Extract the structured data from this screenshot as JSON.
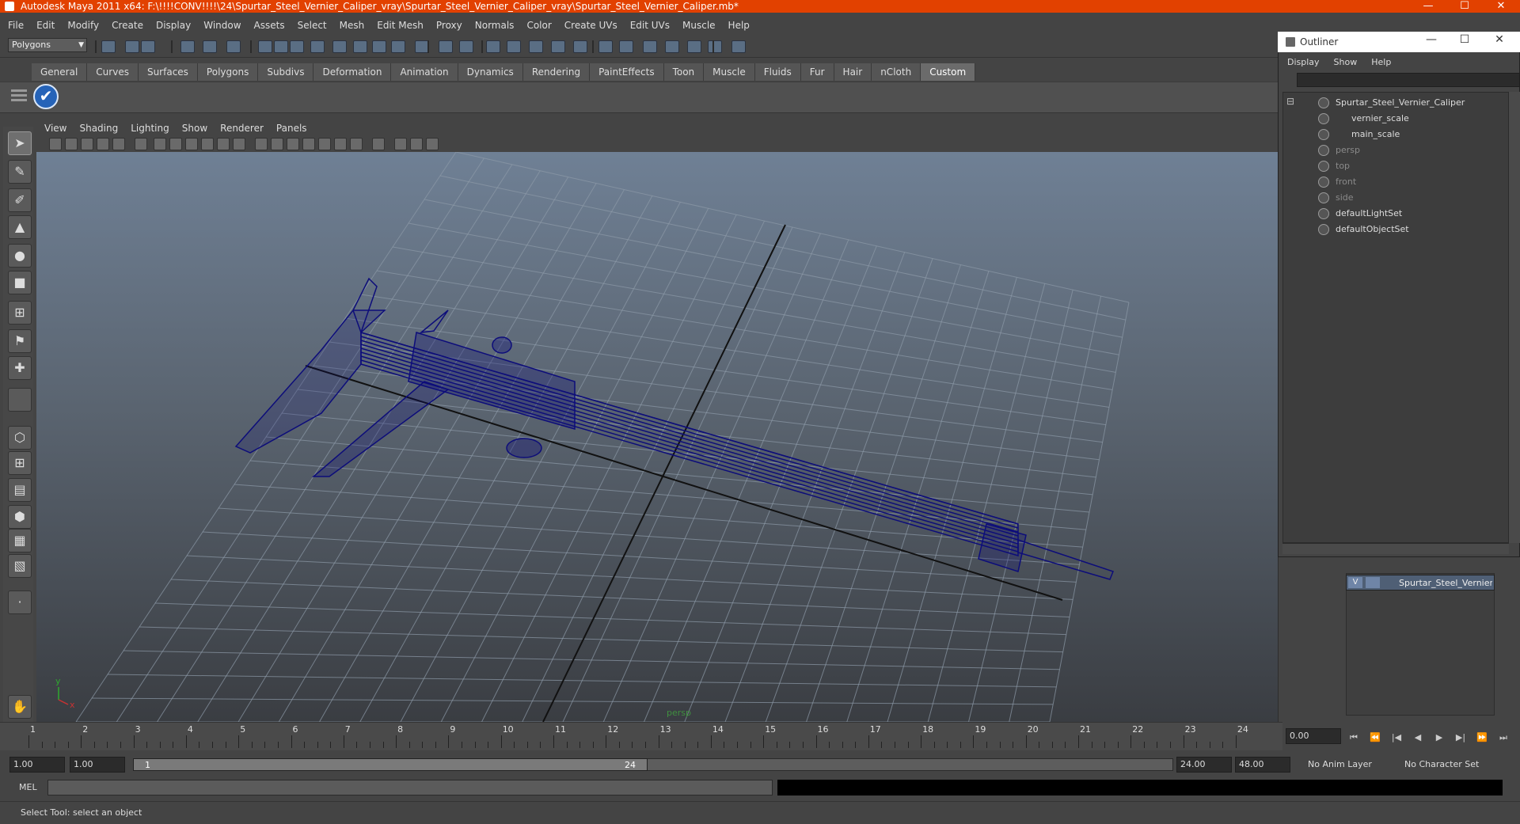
{
  "window": {
    "title": "Autodesk Maya 2011 x64: F:\\!!!!CONV!!!!\\24\\Spurtar_Steel_Vernier_Caliper_vray\\Spurtar_Steel_Vernier_Caliper_vray\\Spurtar_Steel_Vernier_Caliper.mb*",
    "minimize": "—",
    "maximize": "☐",
    "close": "✕"
  },
  "menubar": [
    "File",
    "Edit",
    "Modify",
    "Create",
    "Display",
    "Window",
    "Assets",
    "Select",
    "Mesh",
    "Edit Mesh",
    "Proxy",
    "Normals",
    "Color",
    "Create UVs",
    "Edit UVs",
    "Muscle",
    "Help"
  ],
  "statusline": {
    "mode": "Polygons"
  },
  "shelf": {
    "tabs": [
      "General",
      "Curves",
      "Surfaces",
      "Polygons",
      "Subdivs",
      "Deformation",
      "Animation",
      "Dynamics",
      "Rendering",
      "PaintEffects",
      "Toon",
      "Muscle",
      "Fluids",
      "Fur",
      "Hair",
      "nCloth",
      "Custom"
    ],
    "active_tab": "Custom",
    "custom_button_glyph": "✔"
  },
  "viewport": {
    "menu": [
      "View",
      "Shading",
      "Lighting",
      "Show",
      "Renderer",
      "Panels"
    ],
    "camera": "persp",
    "axis_y": "y",
    "axis_x": "x",
    "colors": {
      "wireframe": "#0d0d7a",
      "grid": "#8d9aa8",
      "axis": "#111111"
    }
  },
  "timeslider": {
    "ticks": [
      "1",
      "2",
      "3",
      "4",
      "5",
      "6",
      "7",
      "8",
      "9",
      "10",
      "11",
      "12",
      "13",
      "14",
      "15",
      "16",
      "17",
      "18",
      "19",
      "20",
      "21",
      "22",
      "23",
      "24"
    ],
    "current_time": "0.00"
  },
  "playback": {
    "buttons": [
      "⏮",
      "⏪",
      "|◀",
      "◀",
      "▶",
      "▶|",
      "⏩",
      "⏭"
    ]
  },
  "range": {
    "start": "1.00",
    "playback_start": "1.00",
    "handle_start": "1",
    "handle_end": "24",
    "playback_end": "24.00",
    "end": "48.00",
    "anim_layer": "No Anim Layer",
    "character_set": "No Character Set"
  },
  "command": {
    "label": "MEL"
  },
  "help_line": "Select Tool: select an object",
  "outliner": {
    "title": "Outliner",
    "menu": [
      "Display",
      "Show",
      "Help"
    ],
    "items": [
      {
        "label": "Spurtar_Steel_Vernier_Caliper",
        "dim": false,
        "indent": 0
      },
      {
        "label": "vernier_scale",
        "dim": false,
        "indent": 1
      },
      {
        "label": "main_scale",
        "dim": false,
        "indent": 1
      },
      {
        "label": "persp",
        "dim": true,
        "indent": 0
      },
      {
        "label": "top",
        "dim": true,
        "indent": 0
      },
      {
        "label": "front",
        "dim": true,
        "indent": 0
      },
      {
        "label": "side",
        "dim": true,
        "indent": 0
      },
      {
        "label": "defaultLightSet",
        "dim": false,
        "indent": 0
      },
      {
        "label": "defaultObjectSet",
        "dim": false,
        "indent": 0
      }
    ]
  },
  "layers": {
    "row": {
      "visible": "V",
      "name": "Spurtar_Steel_Vernier_Caliper"
    }
  }
}
